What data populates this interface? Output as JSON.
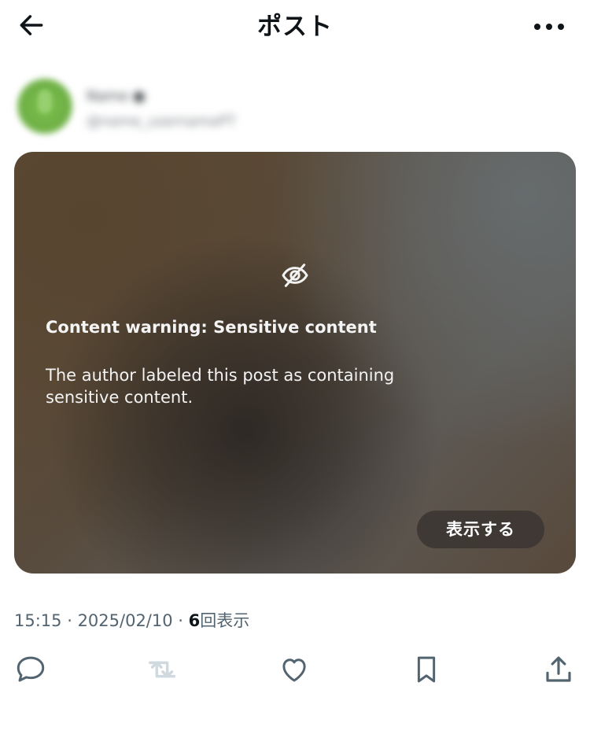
{
  "header": {
    "title": "ポスト",
    "back_icon": "arrow-left-icon",
    "more_icon": "more-horizontal-icon"
  },
  "post": {
    "author_name_obscured": "Name ●",
    "author_handle_obscured": "@name_usernamePT",
    "content_warning": {
      "icon": "eye-off-icon",
      "title": "Content warning: Sensitive content",
      "body": "The author labeled this post as containing sensitive content.",
      "show_button": "表示する"
    },
    "meta": {
      "time": "15:15",
      "separator_1": " · ",
      "date": "2025/02/10",
      "separator_2": " · ",
      "views_count": "6",
      "views_label": "回表示"
    }
  },
  "actions": {
    "reply_icon": "reply-icon",
    "repost_icon": "repost-icon",
    "like_icon": "heart-icon",
    "bookmark_icon": "bookmark-icon",
    "share_icon": "share-icon"
  },
  "colors": {
    "text_primary": "#0f1419",
    "text_secondary": "#536471",
    "repost_disabled": "#cfd9de",
    "avatar_green": "#6fb045"
  }
}
